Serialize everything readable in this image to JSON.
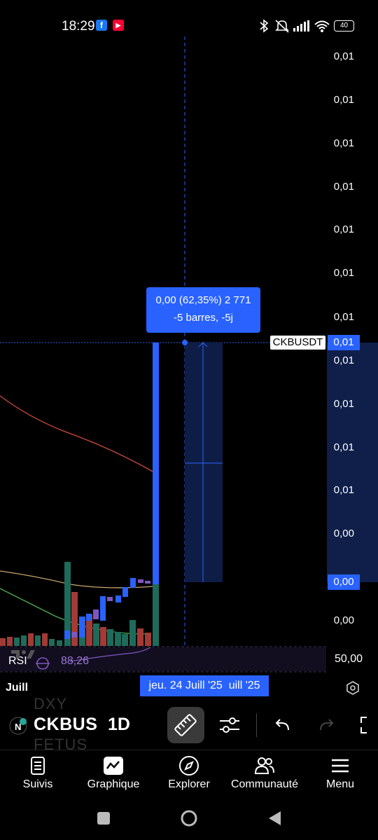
{
  "status_bar": {
    "time": "18:29",
    "battery": "40",
    "notification_apps": [
      "facebook-icon",
      "youtube-icon"
    ],
    "status_icons": [
      "bluetooth-icon",
      "mute-icon",
      "signal-icon",
      "wifi-icon",
      "battery-icon"
    ]
  },
  "chart": {
    "price_axis_labels": [
      "0,01",
      "0,01",
      "0,01",
      "0,01",
      "0,01",
      "0,01",
      "0,01",
      "0,01",
      "0,01",
      "0,01",
      "0,01",
      "0,00",
      "0,00"
    ],
    "tooltip_line1": "0,00 (62,35%) 2 771",
    "tooltip_line2": "-5 barres, -5j",
    "symbol_tag": "CKBUSDT",
    "current_price_tag": "0,01",
    "low_price_tag": "0,00",
    "colors": {
      "accent": "#2962ff",
      "up": "#26a69a",
      "down": "#ef5350",
      "rsi": "#7e57c2"
    }
  },
  "rsi": {
    "label": "RSI",
    "value": "88,26",
    "scale": "50,00"
  },
  "time_axis": {
    "month": "Juill",
    "crosshair_date": "jeu. 24 Juill '25",
    "partial_label": "uill '25"
  },
  "toolbar": {
    "ticker_prev": "DXY",
    "ticker": "CKBUS",
    "ticker_next": "FETUS",
    "interval": "1D",
    "icons": [
      "ruler-icon",
      "sliders-icon",
      "undo-icon",
      "redo-icon",
      "fullscreen-icon"
    ]
  },
  "bottom_nav": {
    "items": [
      {
        "label": "Suivis",
        "icon": "watchlist-icon"
      },
      {
        "label": "Graphique",
        "icon": "chart-icon"
      },
      {
        "label": "Explorer",
        "icon": "compass-icon"
      },
      {
        "label": "Communauté",
        "icon": "community-icon"
      },
      {
        "label": "Menu",
        "icon": "menu-icon"
      }
    ]
  },
  "system_nav": {
    "icons": [
      "recents-icon",
      "home-icon",
      "back-icon"
    ]
  }
}
